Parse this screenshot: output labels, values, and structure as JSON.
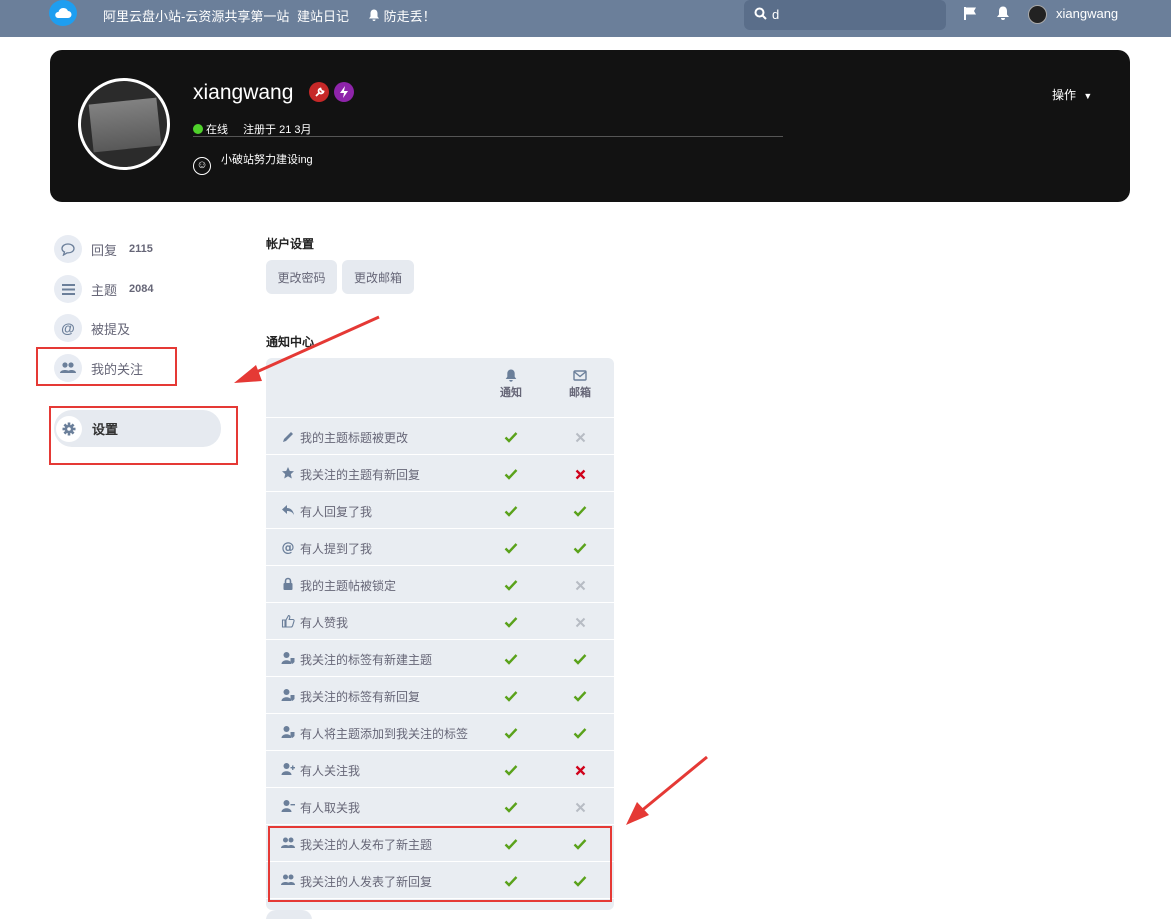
{
  "header": {
    "site_title": "阿里云盘小站-云资源共享第一站",
    "nav_diary": "建站日记",
    "nav_notice": "防走丢！",
    "search_value": "d",
    "username": "xiangwang"
  },
  "profile": {
    "name": "xiangwang",
    "status": "在线",
    "joined": "注册于 21 3月",
    "bio": "小破站努力建设ing",
    "ops_label": "操作"
  },
  "sidebar": {
    "items": [
      {
        "label": "回复",
        "count": "2115"
      },
      {
        "label": "主题",
        "count": "2084"
      },
      {
        "label": "被提及",
        "count": ""
      },
      {
        "label": "我的关注",
        "count": ""
      }
    ],
    "active": "设置"
  },
  "account": {
    "title": "帐户设置",
    "change_password": "更改密码",
    "change_email": "更改邮箱"
  },
  "notifications": {
    "title": "通知中心",
    "col_alert": "通知",
    "col_email": "邮箱",
    "rows": [
      {
        "label": "我的主题标题被更改",
        "icon": "pencil-icon",
        "alert": "check",
        "email": "off"
      },
      {
        "label": "我关注的主题有新回复",
        "icon": "star-icon",
        "alert": "check",
        "email": "cross"
      },
      {
        "label": "有人回复了我",
        "icon": "reply-icon",
        "alert": "check",
        "email": "check"
      },
      {
        "label": "有人提到了我",
        "icon": "at-icon",
        "alert": "check",
        "email": "check"
      },
      {
        "label": "我的主题帖被锁定",
        "icon": "lock-icon",
        "alert": "check",
        "email": "off"
      },
      {
        "label": "有人赞我",
        "icon": "thumbs-up-icon",
        "alert": "check",
        "email": "off"
      },
      {
        "label": "我关注的标签有新建主题",
        "icon": "user-tag-icon",
        "alert": "check",
        "email": "check"
      },
      {
        "label": "我关注的标签有新回复",
        "icon": "user-tag-icon",
        "alert": "check",
        "email": "check"
      },
      {
        "label": "有人将主题添加到我关注的标签",
        "icon": "user-tag-icon",
        "alert": "check",
        "email": "check"
      },
      {
        "label": "有人关注我",
        "icon": "user-plus-icon",
        "alert": "check",
        "email": "cross"
      },
      {
        "label": "有人取关我",
        "icon": "user-minus-icon",
        "alert": "check",
        "email": "off"
      },
      {
        "label": "我关注的人发布了新主题",
        "icon": "users-icon",
        "alert": "check",
        "email": "check"
      },
      {
        "label": "我关注的人发表了新回复",
        "icon": "users-icon",
        "alert": "check",
        "email": "check"
      }
    ]
  },
  "colors": {
    "header_bg": "#6b7f9a",
    "hero_bg": "#121212",
    "check": "#5aa21b",
    "cross": "#d0021b",
    "off": "#b7bcc4",
    "annotation": "#e53935"
  }
}
